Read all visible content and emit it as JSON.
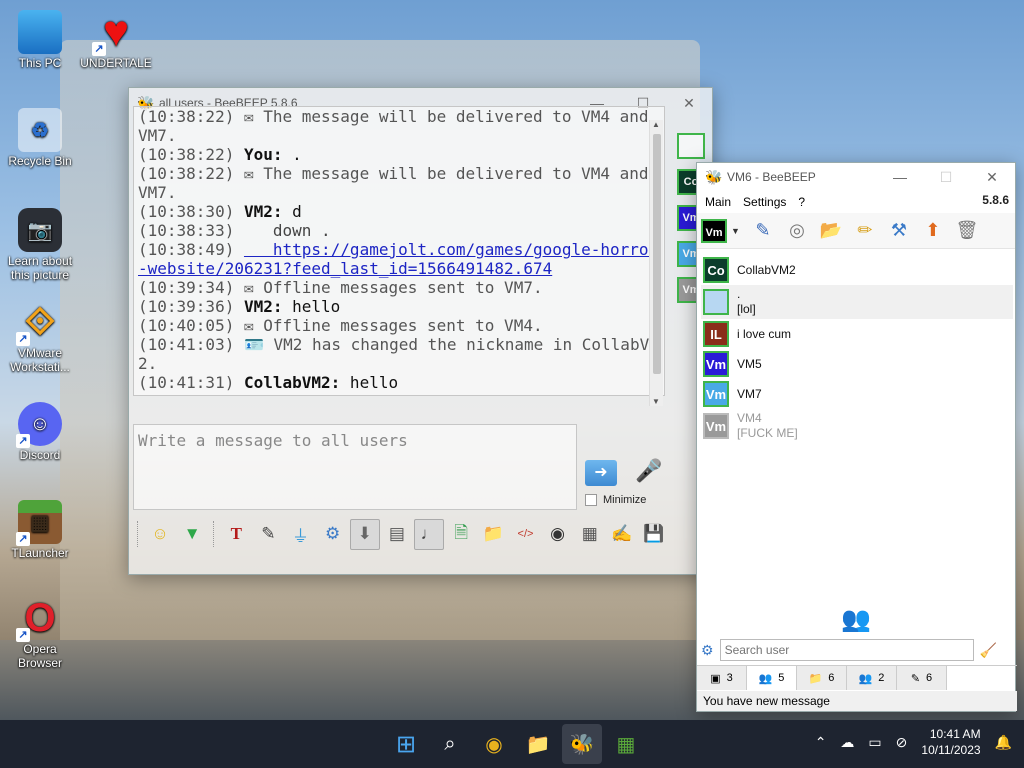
{
  "desktop": {
    "icons": [
      {
        "label": "This PC",
        "glyph": "🖥"
      },
      {
        "label": "UNDERTALE",
        "glyph": "♥"
      },
      {
        "label": "Recycle Bin",
        "glyph": "♻"
      },
      {
        "label": "Learn about this picture",
        "glyph": "📷"
      },
      {
        "label": "VMware Workstati...",
        "glyph": "⟐"
      },
      {
        "label": "Discord",
        "glyph": "☺"
      },
      {
        "label": "TLauncher",
        "glyph": "▦"
      },
      {
        "label": "Opera Browser",
        "glyph": "O"
      }
    ]
  },
  "chat_window": {
    "title": "all users - BeeBEEP 5.8.6",
    "messages": [
      {
        "ts": "(10:38:22)",
        "nick": "",
        "text": "✉ The message will be delivered to VM4 and VM7.",
        "kind": "sys"
      },
      {
        "ts": "(10:38:22)",
        "nick": "You:",
        "text": " .",
        "kind": "msg"
      },
      {
        "ts": "(10:38:22)",
        "nick": "",
        "text": "✉ The message will be delivered to VM4 and VM7.",
        "kind": "sys"
      },
      {
        "ts": "(10:38:30)",
        "nick": "VM2:",
        "text": " d",
        "kind": "msg"
      },
      {
        "ts": "(10:38:33)",
        "nick": "",
        "text": "   down .",
        "kind": "msg"
      },
      {
        "ts": "(10:38:49)",
        "nick": "",
        "text": "   https://gamejolt.com/games/google-horror-website/206231?feed_last_id=1566491482.674",
        "kind": "link"
      },
      {
        "ts": "(10:39:34)",
        "nick": "",
        "text": "✉ Offline messages sent to VM7.",
        "kind": "sys"
      },
      {
        "ts": "(10:39:36)",
        "nick": "VM2:",
        "text": " hello",
        "kind": "msg"
      },
      {
        "ts": "(10:40:05)",
        "nick": "",
        "text": "✉ Offline messages sent to VM4.",
        "kind": "sys"
      },
      {
        "ts": "(10:41:03)",
        "nick": "",
        "text": "🪪 VM2 has changed the nickname in CollabVM2.",
        "kind": "sys"
      },
      {
        "ts": "(10:41:31)",
        "nick": "CollabVM2:",
        "text": " hello",
        "kind": "msg"
      }
    ],
    "input_placeholder": "Write a message to all users",
    "minimize_label": "Minimize",
    "toolbar_icons": [
      "smiley-icon",
      "green-arrow-icon",
      "font-icon",
      "color-icon",
      "filter-icon",
      "gear-icon",
      "save-chat-icon",
      "clear-icon",
      "sticky-icon",
      "file-icon",
      "folder-send-icon",
      "html-icon",
      "screenshot-icon",
      "print-icon",
      "edit-icon",
      "save-icon"
    ]
  },
  "main_window": {
    "title": "VM6 - BeeBEEP",
    "version": "5.8.6",
    "menu": [
      "Main",
      "Settings",
      "?"
    ],
    "status_avatar": "Vm",
    "users": [
      {
        "initials": "Co",
        "name": "CollabVM2",
        "sub": "",
        "bg": "#0b3d2b",
        "offline": false
      },
      {
        "initials": "",
        "name": ".",
        "sub": "[lol]",
        "bg": "#b7d7f2",
        "offline": false
      },
      {
        "initials": "IL",
        "name": "i love cum",
        "sub": "",
        "bg": "#8a2d1a",
        "offline": false
      },
      {
        "initials": "Vm",
        "name": "VM5",
        "sub": "",
        "bg": "#2a1bd6",
        "offline": false
      },
      {
        "initials": "Vm",
        "name": "VM7",
        "sub": "",
        "bg": "#49a9e6",
        "offline": false
      },
      {
        "initials": "Vm",
        "name": "VM4",
        "sub": "[FUCK ME]",
        "bg": "#9a9a9a",
        "offline": true
      }
    ],
    "search_placeholder": "Search user",
    "tabs": [
      {
        "icon": "▣",
        "count": "3"
      },
      {
        "icon": "👥",
        "count": "5"
      },
      {
        "icon": "📁",
        "count": "6"
      },
      {
        "icon": "👥",
        "count": "2"
      },
      {
        "icon": "✎",
        "count": "6"
      }
    ],
    "status": "You have new message"
  },
  "taskbar": {
    "time": "10:41 AM",
    "date": "10/11/2023"
  }
}
